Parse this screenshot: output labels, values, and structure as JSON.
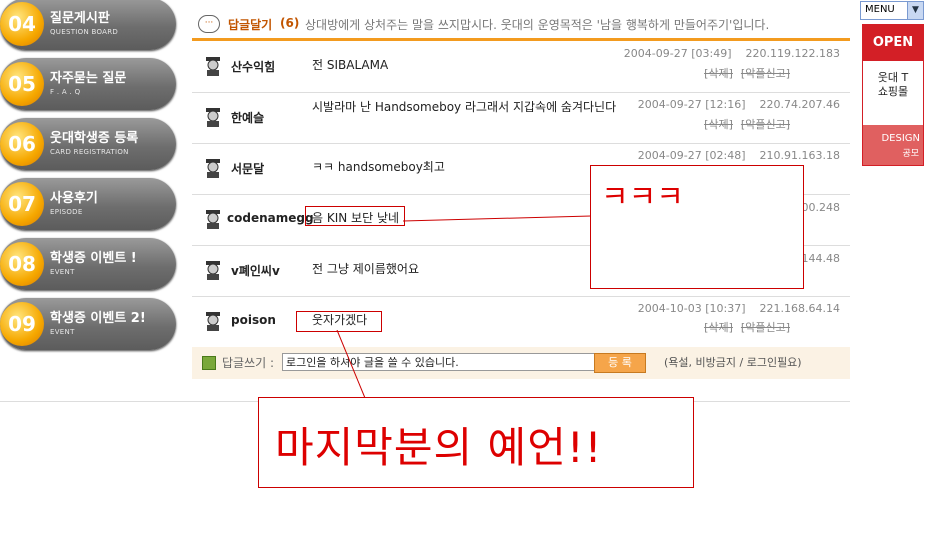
{
  "nav": [
    {
      "num": "04",
      "title": "질문게시판",
      "sub": "QUESTION BOARD"
    },
    {
      "num": "05",
      "title": "자주묻는 질문",
      "sub": "F . A . Q"
    },
    {
      "num": "06",
      "title": "웃대학생증 등록",
      "sub": "CARD REGISTRATION"
    },
    {
      "num": "07",
      "title": "사용후기",
      "sub": "EPISODE"
    },
    {
      "num": "08",
      "title": "학생증 이벤트 !",
      "sub": "EVENT"
    },
    {
      "num": "09",
      "title": "학생증 이벤트 2!",
      "sub": "EVENT"
    }
  ],
  "header": {
    "icon": "comment-bubble-icon",
    "title": "답글달기",
    "count": "(6)",
    "message": "상대방에게 상처주는 말을 쓰지맙시다. 웃대의 운영목적은 '남을 행복하게 만들어주기'입니다."
  },
  "comments": [
    {
      "author": "산수익힘",
      "text": "전 SIBALAMA",
      "datetime": "2004-09-27 [03:49]",
      "ip": "220.119.122.183",
      "delete": "[삭제]",
      "report": "[악플신고]"
    },
    {
      "author": "한예슬",
      "text": "시발라마 난 Handsomeboy 라그래서 지갑속에 숨겨다닌다",
      "datetime": "2004-09-27 [12:16]",
      "ip": "220.74.207.46",
      "delete": "[삭제]",
      "report": "[악플신고]"
    },
    {
      "author": "서문달",
      "text": "ㅋㅋ handsomeboy최고",
      "datetime": "2004-09-27 [02:48]",
      "ip": "210.91.163.18",
      "delete": "",
      "report": ""
    },
    {
      "author": "codenamegg",
      "text": "음 KIN 보단 낮네",
      "datetime": "",
      "ip": "00.248",
      "delete": "",
      "report": ""
    },
    {
      "author": "v폐인씨v",
      "text": "전 그냥 제이름했어요",
      "datetime": "",
      "ip": "144.48",
      "delete": "",
      "report": ""
    },
    {
      "author": "poison",
      "text": "웃자가겠다",
      "datetime": "2004-10-03 [10:37]",
      "ip": "221.168.64.14",
      "delete": "[삭제]",
      "report": "[악플신고]"
    }
  ],
  "reply": {
    "label": "답글쓰기 :",
    "value": "로그인을 하셔야 글을 쓸 수 있습니다.",
    "button": "등 록",
    "note": "(욕설, 비방금지 / 로그인필요)"
  },
  "right": {
    "menu": "MENU",
    "ad_top": "OPEN",
    "ad_line1": "웃대 T",
    "ad_line2": "쇼핑몰",
    "ad_design": "DESIGN",
    "ad_small": "공모"
  },
  "overlays": {
    "big_text": "ㅋㅋㅋ",
    "prophecy": "마지막분의  예언!!"
  },
  "colors": {
    "accent": "#f39b1f",
    "header_text": "#c25500",
    "annotation": "#cc0000",
    "ad_red": "#d31f26"
  }
}
